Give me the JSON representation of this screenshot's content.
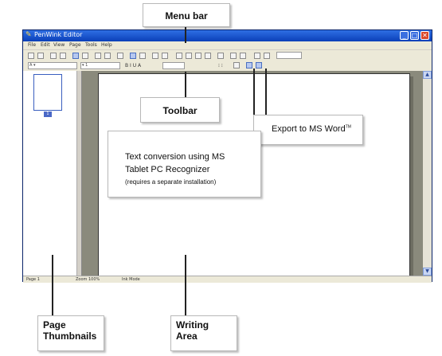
{
  "window": {
    "title": "PenWink Editor",
    "controls": {
      "minimize": "_",
      "maximize": "□",
      "close": "✕"
    }
  },
  "menubar": {
    "items": [
      "File",
      "Edit",
      "View",
      "Page",
      "Tools",
      "Help"
    ]
  },
  "toolbar2": {
    "font_combo": "A ▾",
    "size_combo": "▾ 1",
    "format_glyphs": "B  I  U  A",
    "extra_glyphs": "⁝ ⁝"
  },
  "thumbnails": {
    "page_number": "1"
  },
  "statusbar": {
    "page": "Page 1",
    "zoom": "Zoom 100%",
    "mode": "Ink Mode"
  },
  "callouts": {
    "menu_bar": "Menu bar",
    "toolbar": "Toolbar",
    "export": "Export to MS Word",
    "export_tm": "TM",
    "text_conversion_line1": "Text conversion using MS",
    "text_conversion_line2": "Tablet PC Recognizer",
    "text_conversion_note": "(requires a separate installation)",
    "page_thumbnails_line1": "Page",
    "page_thumbnails_line2": "Thumbnails",
    "writing_area_line1": "Writing",
    "writing_area_line2": "Area"
  },
  "colors": {
    "titlebar": "#0a3fb8",
    "chrome": "#ece9d8",
    "workspace": "#8a8a7c"
  }
}
